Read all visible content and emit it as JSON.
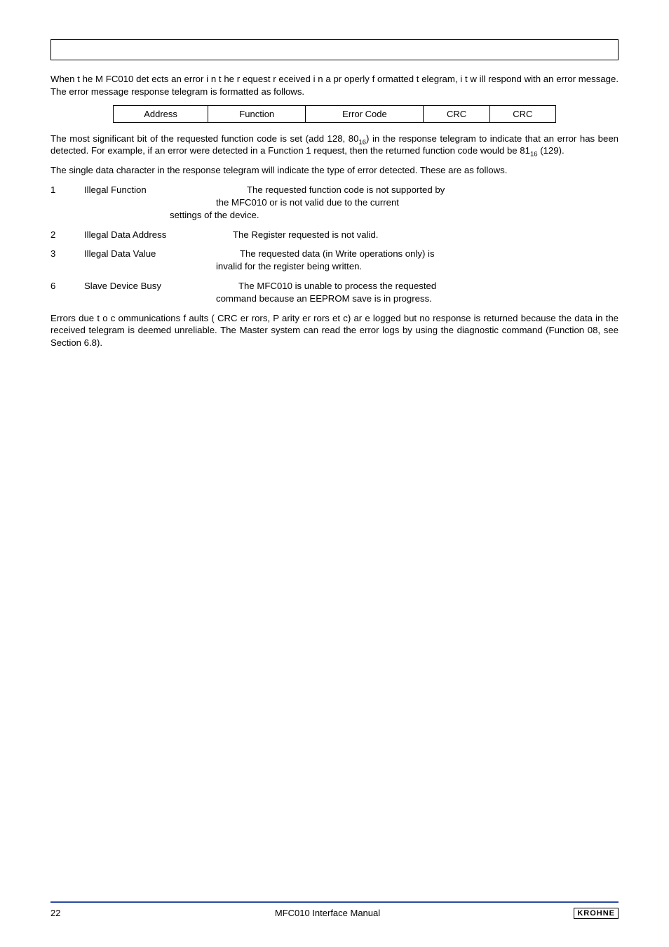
{
  "intro": {
    "p1": "When t he M FC010 det ects an  error i n t he r equest r eceived i n a pr operly f ormatted t elegram, i t w ill respond with an error message.  The error message response telegram is formatted as follows."
  },
  "telegram": {
    "c1": "Address",
    "c2": "Function",
    "c3": "Error Code",
    "c4": "CRC",
    "c5": "CRC"
  },
  "para": {
    "p2a": "The most significant bit of the requested function code is set (add 128, 80",
    "p2b": ") in the response telegram to indicate that an error has been detected.  For example, if an error were detected in a Function 1 request, then the returned function code would be 81",
    "p2c": " (129).",
    "sub16": "16",
    "p3": "The single data character in the response telegram will indicate the type of error detected.  These are as follows."
  },
  "errors": {
    "e1": {
      "code": "1",
      "name": "Illegal Function",
      "l1": "The requested function code is not supported by",
      "l2": "the MFC010 or is not valid due to the current",
      "l3": "settings of the device."
    },
    "e2": {
      "code": "2",
      "name": "Illegal Data Address",
      "l1": "The Register requested is not valid."
    },
    "e3": {
      "code": "3",
      "name": "Illegal Data Value",
      "l1": "The requested data (in Write operations only) is",
      "l2": "invalid for the register being written."
    },
    "e6": {
      "code": "6",
      "name": "Slave Device Busy",
      "l1": "The MFC010 is unable to process the requested",
      "l2": "command because an EEPROM save is in progress."
    }
  },
  "closing": {
    "p4": "Errors due t o c ommunications f aults ( CRC er rors, P arity er rors et c) ar e  logged  but  no  response  is returned because the data in the received telegram is deemed unreliable.  The Master system can read the error logs by using the diagnostic command (Function 08, see Section 6.8)."
  },
  "footer": {
    "page": "22",
    "title": "MFC010 Interface Manual",
    "brand": "KROHNE"
  }
}
